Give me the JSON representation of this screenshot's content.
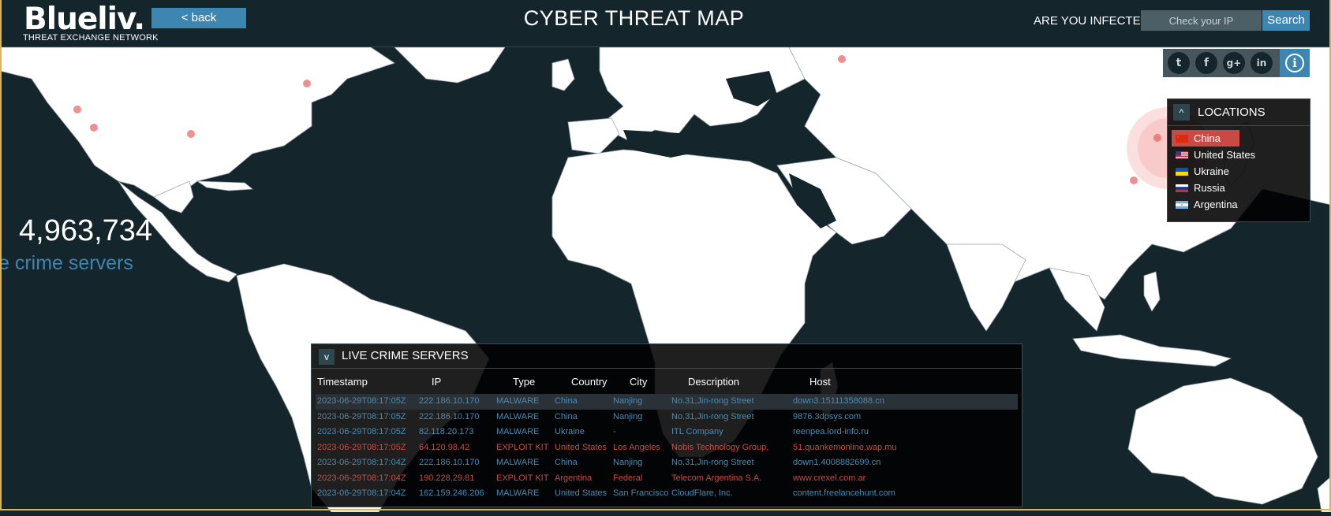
{
  "header": {
    "logo": "Blueliv.",
    "logo_subtitle": "THREAT EXCHANGE NETWORK",
    "back_label": "< back",
    "title": "CYBER THREAT MAP",
    "infected_label": "ARE YOU INFECTED?",
    "ip_placeholder": "Check your IP",
    "search_label": "Search"
  },
  "stats": {
    "count": "4,963,734",
    "label": "e crime servers"
  },
  "social": {
    "icons": [
      "twitter-icon",
      "facebook-icon",
      "google-plus-icon",
      "linkedin-icon",
      "info-icon"
    ]
  },
  "locations": {
    "title": "LOCATIONS",
    "items": [
      {
        "label": "China",
        "active": true
      },
      {
        "label": "United States",
        "active": false
      },
      {
        "label": "Ukraine",
        "active": false
      },
      {
        "label": "Russia",
        "active": false
      },
      {
        "label": "Argentina",
        "active": false
      }
    ]
  },
  "live_servers": {
    "title": "LIVE CRIME SERVERS",
    "columns": [
      "Timestamp",
      "IP",
      "Type",
      "Country",
      "City",
      "Description",
      "Host"
    ],
    "rows": [
      {
        "timestamp": "2023-06-29T08:17:05Z",
        "ip": "222.186.10.170",
        "type": "MALWARE",
        "country": "China",
        "city": "Nanjing",
        "description": "No.31,Jin-rong Street",
        "host": "down3.15111358088.cn"
      },
      {
        "timestamp": "2023-06-29T08:17:05Z",
        "ip": "222.186.10.170",
        "type": "MALWARE",
        "country": "China",
        "city": "Nanjing",
        "description": "No.31,Jin-rong Street",
        "host": "9876.3dpsys.com"
      },
      {
        "timestamp": "2023-06-29T08:17:05Z",
        "ip": "82.118.20.173",
        "type": "MALWARE",
        "country": "Ukraine",
        "city": "-",
        "description": "ITL Company",
        "host": "reenpea.lord-info.ru"
      },
      {
        "timestamp": "2023-06-29T08:17:05Z",
        "ip": "64.120.98.42",
        "type": "EXPLOIT KIT",
        "country": "United States",
        "city": "Los Angeles",
        "description": "Nobis Technology Group,",
        "host": "51.quankemonline.wap.mu"
      },
      {
        "timestamp": "2023-06-29T08:17:04Z",
        "ip": "222.186.10.170",
        "type": "MALWARE",
        "country": "China",
        "city": "Nanjing",
        "description": "No.31,Jin-rong Street",
        "host": "down1.4008882699.cn"
      },
      {
        "timestamp": "2023-06-29T08:17:04Z",
        "ip": "190.228.29.81",
        "type": "EXPLOIT KIT",
        "country": "Argentina",
        "city": "Federal",
        "description": "Telecom Argentina S.A.",
        "host": "www.crexel.com.ar"
      },
      {
        "timestamp": "2023-06-29T08:17:04Z",
        "ip": "162.159.246.206",
        "type": "MALWARE",
        "country": "United States",
        "city": "San Francisco",
        "description": "CloudFlare, Inc.",
        "host": "content.freelancehunt.com"
      }
    ]
  },
  "colors": {
    "background": "#14252c",
    "land": "#ffffff",
    "accent": "#3e86b2",
    "malware": "#4a8bb3",
    "exploit": "#c94a45"
  }
}
